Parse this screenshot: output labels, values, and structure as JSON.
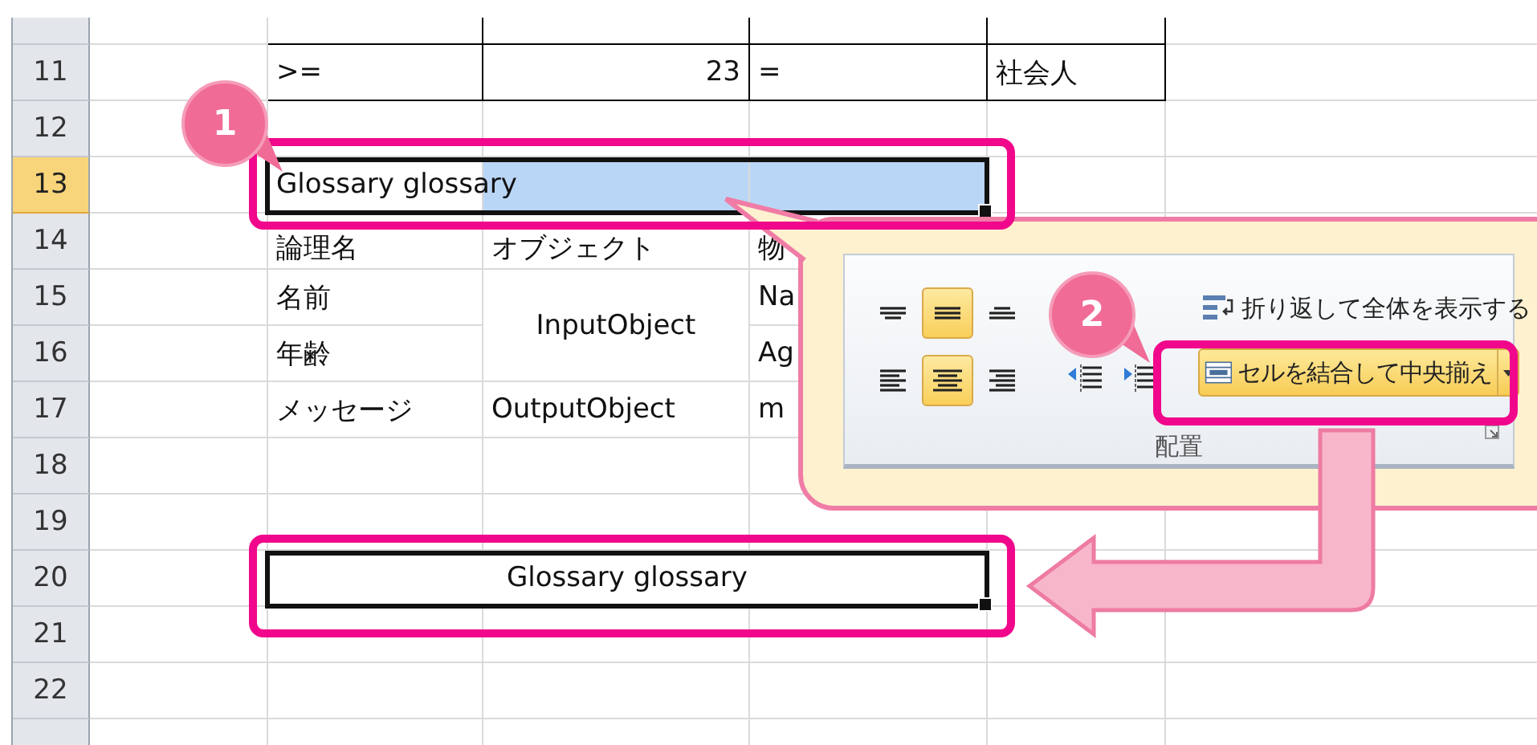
{
  "sheet": {
    "rows": [
      {
        "header_selected": false,
        "bordered": true
      },
      {
        "header": "11",
        "header_selected": false,
        "bordered": true,
        "column_b": ">=",
        "column_c": "23",
        "column_d": "=",
        "column_e": "社会人"
      },
      {
        "header": "12",
        "header_selected": false
      },
      {
        "header": "13",
        "header_selected": true,
        "selected_range": true,
        "column_b": "Glossary glossary"
      },
      {
        "header": "14",
        "header_selected": false,
        "column_b": "論理名",
        "column_c": "オブジェクト",
        "column_d": "物"
      },
      {
        "header": "15",
        "header_selected": false,
        "column_b": "名前",
        "column_c": "InputObject",
        "column_c_merged_with_next": true,
        "column_d": "Na"
      },
      {
        "header": "16",
        "header_selected": false,
        "column_b": "年齢",
        "column_d": "Ag"
      },
      {
        "header": "17",
        "header_selected": false,
        "column_b": "メッセージ",
        "column_c": "OutputObject",
        "column_d": "m"
      },
      {
        "header": "18",
        "header_selected": false
      },
      {
        "header": "19",
        "header_selected": false
      },
      {
        "header": "20",
        "header_selected": false,
        "selected_range": true,
        "merged": true,
        "column_b": "Glossary glossary"
      },
      {
        "header": "21",
        "header_selected": false
      },
      {
        "header": "22",
        "header_selected": false
      },
      {
        "header_selected": false
      }
    ]
  },
  "callouts": [
    {
      "number": "1"
    },
    {
      "number": "2"
    }
  ],
  "ribbon_group": {
    "title": "配置",
    "alignment_buttons": [
      {
        "kind": "top",
        "selected": false
      },
      {
        "kind": "middle",
        "selected": true
      },
      {
        "kind": "bottom",
        "selected": false
      },
      {
        "kind": "left",
        "selected": false
      },
      {
        "kind": "center",
        "selected": true
      },
      {
        "kind": "right",
        "selected": false
      }
    ],
    "wrap_text_button": {
      "label": "折り返して全体を表示する"
    },
    "merge_button": {
      "label": "セルを結合して中央揃え",
      "selected": true
    }
  }
}
